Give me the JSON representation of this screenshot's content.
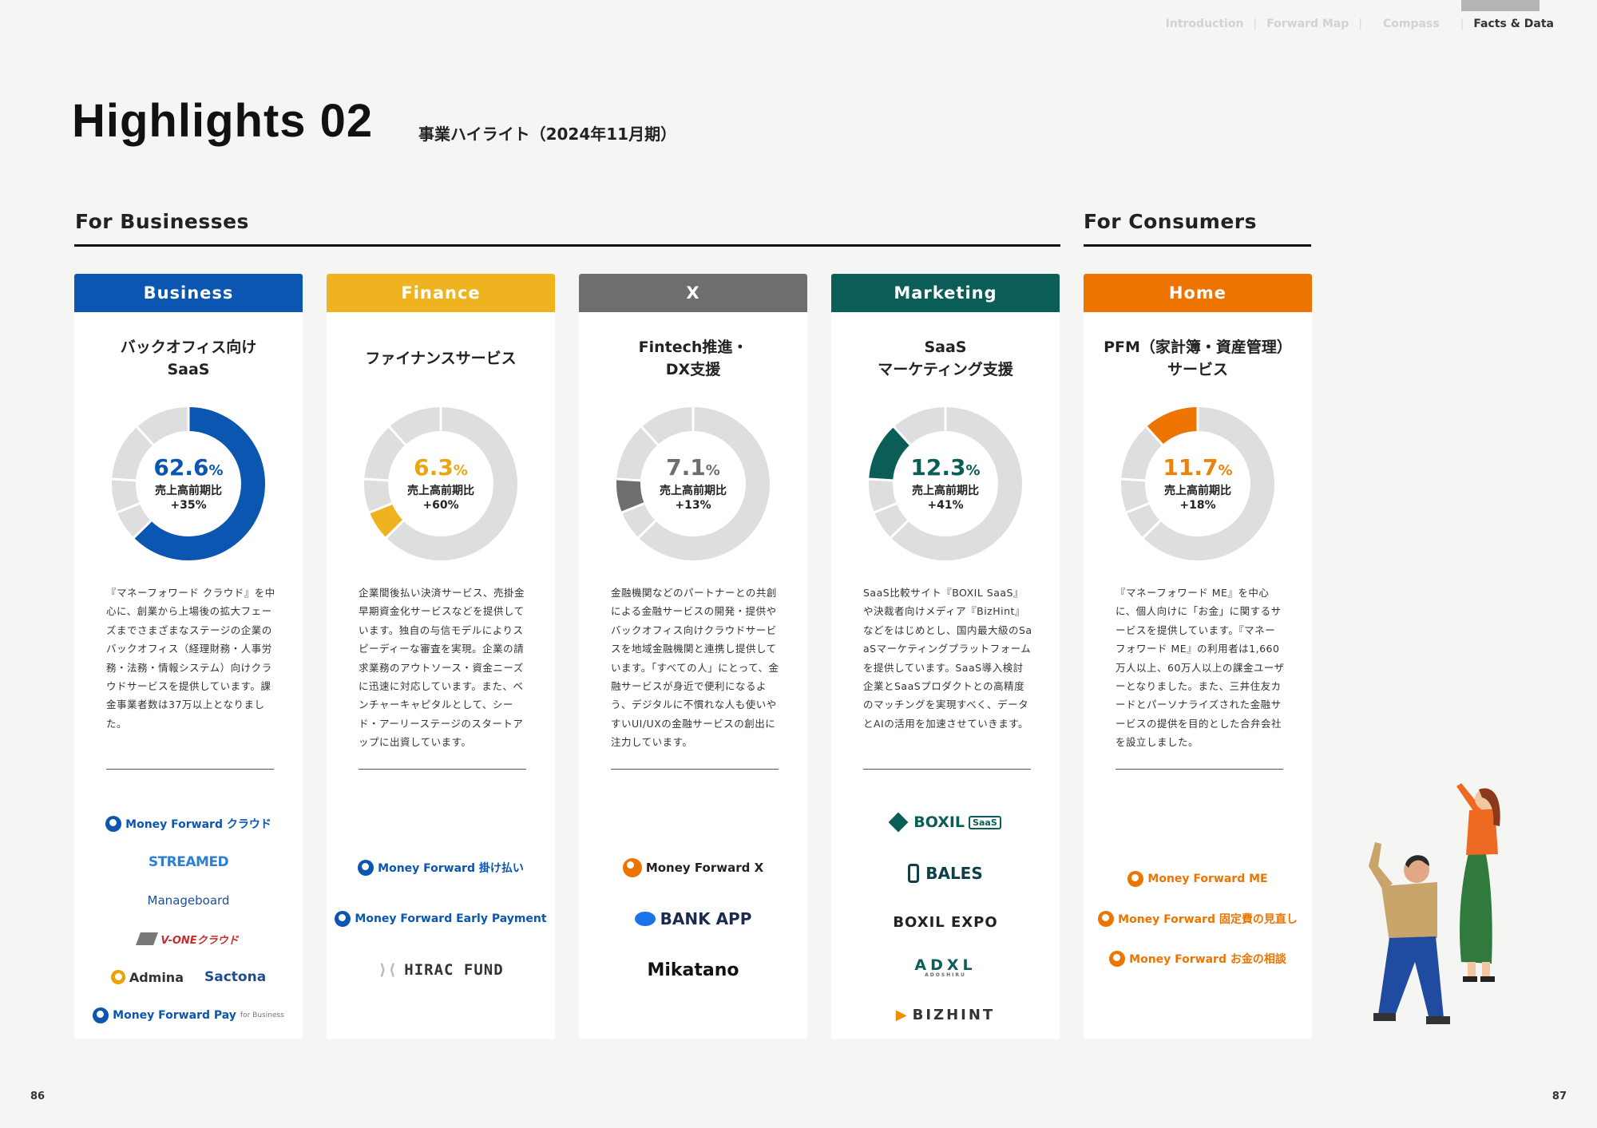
{
  "nav": {
    "items": [
      {
        "label": "Introduction",
        "active": false
      },
      {
        "label": "Forward Map",
        "active": false
      },
      {
        "label": "Compass",
        "active": false
      },
      {
        "label": "Facts & Data",
        "active": true
      }
    ]
  },
  "header": {
    "title": "Highlights 02",
    "subtitle": "事業ハイライト（2024年11月期）"
  },
  "sections": {
    "businesses": "For Businesses",
    "consumers": "For Consumers"
  },
  "colors": {
    "business": "#0a56b0",
    "finance": "#f0b320",
    "x": "#6e6e6e",
    "marketing": "#0b5e57",
    "home": "#ee7400",
    "track": "#dedede"
  },
  "cards": [
    {
      "header": "Business",
      "title": [
        "バックオフィス向け",
        "SaaS"
      ],
      "share": 62.6,
      "share_label": "62.6",
      "pct_sign": "%",
      "yoy_label": "売上高前期比",
      "yoy_value": "+35%",
      "description": "『マネーフォワード クラウド』を中心に、創業から上場後の拡大フェーズまでさまざまなステージの企業のバックオフィス（経理財務・人事労務・法務・情報システム）向けクラウドサービスを提供しています。課金事業者数は37万以上となりました。",
      "logos": [
        "Money Forward クラウド",
        "STREAMED",
        "Manageboard",
        "V-ONEクラウド",
        "Admina",
        "Sactona",
        "Money Forward Pay",
        "for Business"
      ]
    },
    {
      "header": "Finance",
      "title": [
        "ファイナンスサービス"
      ],
      "share": 6.3,
      "share_label": "6.3",
      "pct_sign": "%",
      "yoy_label": "売上高前期比",
      "yoy_value": "+60%",
      "description": "企業間後払い決済サービス、売掛金早期資金化サービスなどを提供しています。独自の与信モデルによりスピーディーな審査を実現。企業の請求業務のアウトソース・資金ニーズに迅速に対応しています。また、ベンチャーキャピタルとして、シード・アーリーステージのスタートアップに出資しています。",
      "logos": [
        "Money Forward 掛け払い",
        "Money Forward Early Payment",
        "HIRAC FUND"
      ]
    },
    {
      "header": "X",
      "title": [
        "Fintech推進・",
        "DX支援"
      ],
      "share": 7.1,
      "share_label": "7.1",
      "pct_sign": "%",
      "yoy_label": "売上高前期比",
      "yoy_value": "+13%",
      "description": "金融機関などのパートナーとの共創による金融サービスの開発・提供やバックオフィス向けクラウドサービスを地域金融機関と連携し提供しています。「すべての人」にとって、金融サービスが身近で便利になるよう、デジタルに不慣れな人も使いやすいUI/UXの金融サービスの創出に注力しています。",
      "logos": [
        "Money Forward X",
        "BANK APP",
        "Mikatano"
      ]
    },
    {
      "header": "Marketing",
      "title": [
        "SaaS",
        "マーケティング支援"
      ],
      "share": 12.3,
      "share_label": "12.3",
      "pct_sign": "%",
      "yoy_label": "売上高前期比",
      "yoy_value": "+41%",
      "description": "SaaS比較サイト『BOXIL SaaS』や決裁者向けメディア『BizHint』などをはじめとし、国内最大級のSaaSマーケティングプラットフォームを提供しています。SaaS導入検討企業とSaaSプロダクトとの高精度のマッチングを実現すべく、データとAIの活用を加速させていきます。",
      "logos": [
        "BOXIL",
        "SaaS",
        "BALES",
        "BOXIL EXPO",
        "ADXL",
        "ADOSHIRU",
        "BIZHINT"
      ]
    },
    {
      "header": "Home",
      "title": [
        "PFM（家計簿・資産管理）",
        "サービス"
      ],
      "share": 11.7,
      "share_label": "11.7",
      "pct_sign": "%",
      "yoy_label": "売上高前期比",
      "yoy_value": "+18%",
      "description": "『マネーフォワード ME』を中心に、個人向けに「お金」に関するサービスを提供しています。『マネーフォワード ME』の利用者は1,660万人以上、60万人以上の課金ユーザーとなりました。また、三井住友カードとパーソナライズされた金融サービスの提供を目的とした合弁会社を設立しました。",
      "logos": [
        "Money Forward ME",
        "Money Forward 固定費の見直し",
        "Money Forward お金の相談"
      ]
    }
  ],
  "pages": {
    "left": "86",
    "right": "87"
  }
}
